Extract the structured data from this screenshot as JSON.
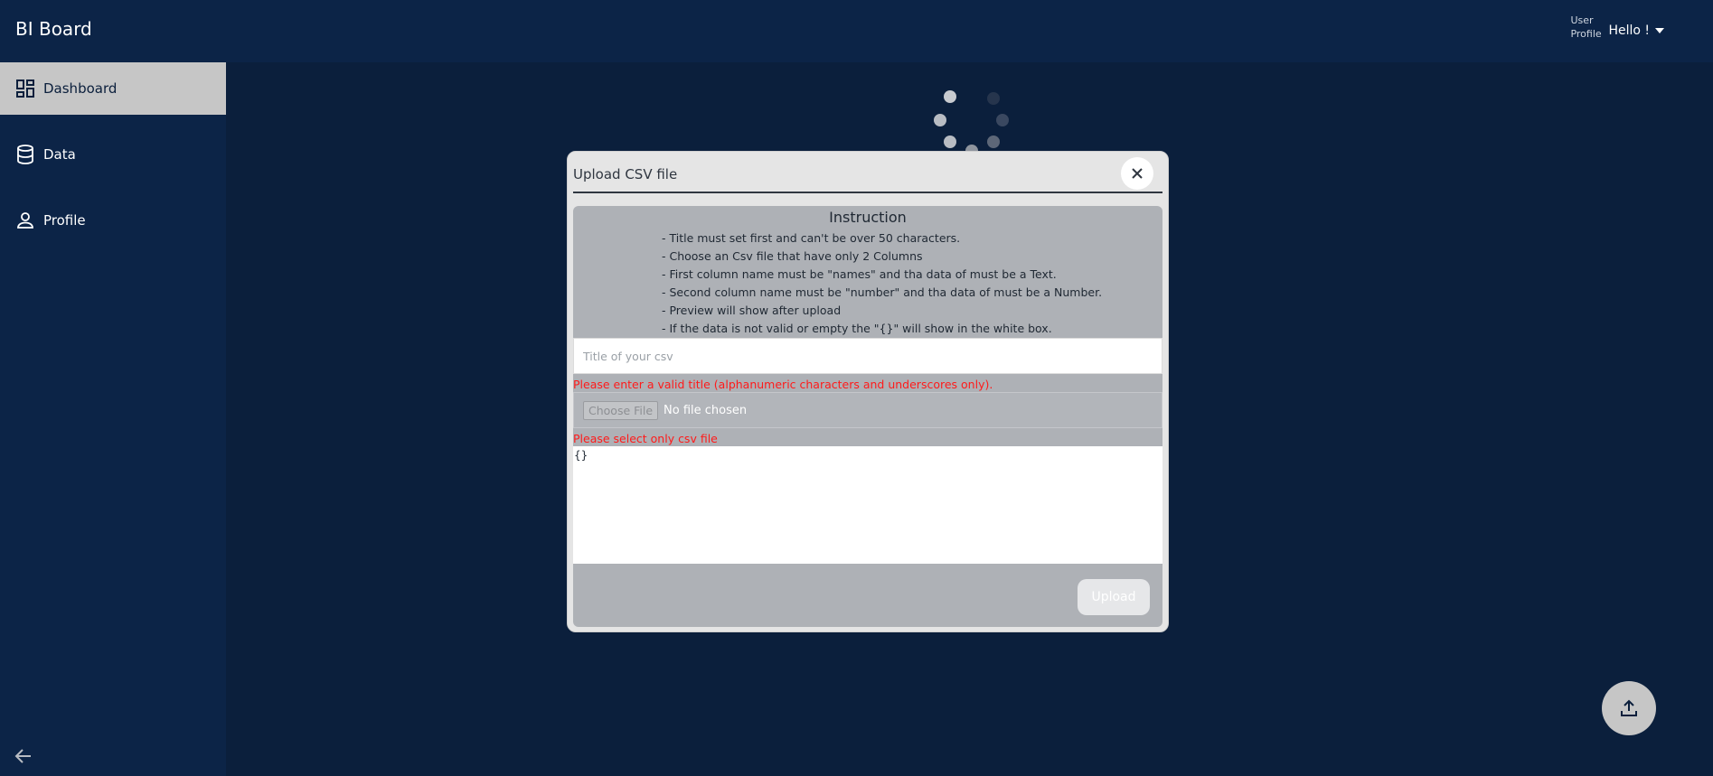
{
  "app": {
    "title": "BI Board"
  },
  "user": {
    "avatar_alt": "User Profile",
    "greeting": "Hello !"
  },
  "sidebar": {
    "items": [
      {
        "label": "Dashboard",
        "icon": "dashboard-icon",
        "active": true
      },
      {
        "label": "Data",
        "icon": "database-icon",
        "active": false
      },
      {
        "label": "Profile",
        "icon": "person-icon",
        "active": false
      }
    ],
    "collapse_icon": "arrow-left-icon"
  },
  "modal": {
    "title": "Upload CSV file",
    "close_icon": "close-icon",
    "instruction_title": "Instruction",
    "instructions": [
      "- Title must set first and can't be over 50 characters.",
      "- Choose an Csv file that have only 2 Columns",
      "- First column name must be \"names\" and tha data of must be a Text.",
      "- Second column name must be \"number\" and tha data of must be a Number.",
      "- Preview will show after upload",
      "- If the data is not valid or empty the \"{}\" will show in the white box."
    ],
    "title_input": {
      "placeholder": "Title of your csv",
      "value": ""
    },
    "title_error": "Please enter a valid title (alphanumeric characters and underscores only).",
    "file_input": {
      "button_label": "Choose File",
      "status": "No file chosen"
    },
    "file_error": "Please select only csv file",
    "preview_text": "{}",
    "upload_label": "Upload"
  },
  "fab": {
    "icon": "upload-icon"
  },
  "colors": {
    "page_bg": "#0b1f3c",
    "sidebar_bg": "#0c2447",
    "active_item_bg": "#c6c6c6",
    "error": "#ff1a1a",
    "modal_bg": "#e5e5e5",
    "modal_body_bg": "#aeb1b6"
  }
}
